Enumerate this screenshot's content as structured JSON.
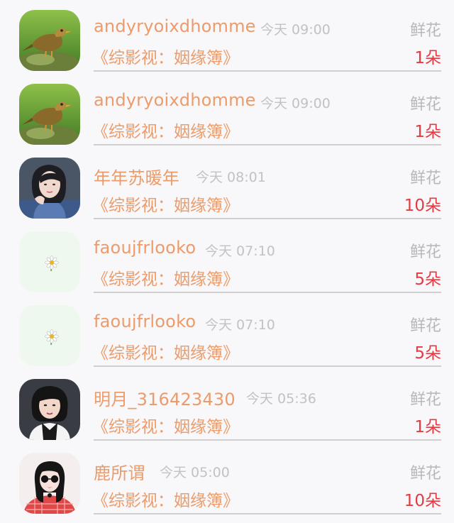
{
  "gift_list": [
    {
      "name": "andyryoixdhomme",
      "time": "今天 09:00",
      "gift": "鲜花",
      "work": "《综影视：姻缘簿》",
      "count": "1朵",
      "avatar": "bird"
    },
    {
      "name": "andyryoixdhomme",
      "time": "今天 09:00",
      "gift": "鲜花",
      "work": "《综影视：姻缘簿》",
      "count": "1朵",
      "avatar": "bird"
    },
    {
      "name": "年年苏暖年",
      "time": "今天 08:01",
      "gift": "鲜花",
      "work": "《综影视：姻缘簿》",
      "count": "10朵",
      "avatar": "woman-portrait"
    },
    {
      "name": "faoujfrlooko",
      "time": "今天 07:10",
      "gift": "鲜花",
      "work": "《综影视：姻缘簿》",
      "count": "5朵",
      "avatar": "flower"
    },
    {
      "name": "faoujfrlooko",
      "time": "今天 07:10",
      "gift": "鲜花",
      "work": "《综影视：姻缘簿》",
      "count": "5朵",
      "avatar": "flower"
    },
    {
      "name": "明月_316423430",
      "time": "今天 05:36",
      "gift": "鲜花",
      "work": "《综影视：姻缘簿》",
      "count": "1朵",
      "avatar": "woman-photo"
    },
    {
      "name": "鹿所谓",
      "time": "今天 05:00",
      "gift": "鲜花",
      "work": "《综影视：姻缘簿》",
      "count": "10朵",
      "avatar": "illustration-sunglasses"
    }
  ]
}
